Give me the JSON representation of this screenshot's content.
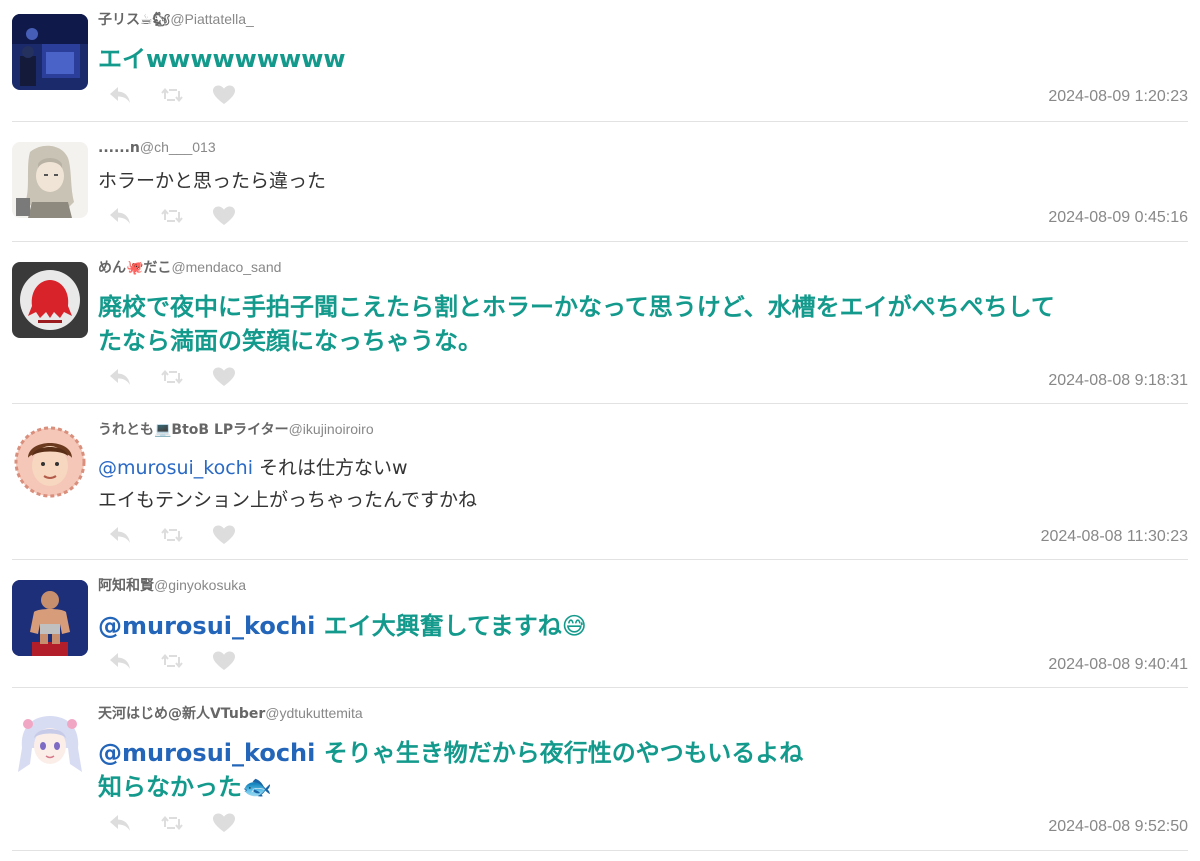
{
  "colors": {
    "accent_text": "#149a8c",
    "mention": "#2365b8",
    "meta": "#888888",
    "icon": "#dddddd",
    "divider": "#e2e2e2"
  },
  "tweets": [
    {
      "username": "子リス☕🐿",
      "handle": "@Piattatella_",
      "text_lines": [
        "エイwwwwwwwww"
      ],
      "mention": "",
      "timestamp": "2024-08-09 1:20:23",
      "style": "large",
      "avatar_icon": "aquarium-photo"
    },
    {
      "username": "......n",
      "handle": "@ch___013",
      "text_lines": [
        "ホラーかと思ったら違った"
      ],
      "mention": "",
      "timestamp": "2024-08-09 0:45:16",
      "style": "small",
      "avatar_icon": "anime-character"
    },
    {
      "username": "めん🐙だこ",
      "handle": "@mendaco_sand",
      "text_lines": [
        "廃校で夜中に手拍子聞こえたら割とホラーかなって思うけど、水槽をエイがぺちぺちして",
        "たなら満面の笑顔になっちゃうな。"
      ],
      "mention": "",
      "timestamp": "2024-08-08 9:18:31",
      "style": "large",
      "avatar_icon": "red-octopus-logo"
    },
    {
      "username": "うれとも💻BtoB LPライター",
      "handle": "@ikujinoiroiro",
      "text_lines": [
        " それは仕方ないw",
        "エイもテンション上がっちゃったんですかね"
      ],
      "mention": "@murosui_kochi",
      "timestamp": "2024-08-08 11:30:23",
      "style": "small",
      "avatar_icon": "face-illustration"
    },
    {
      "username": "阿知和賢",
      "handle": "@ginyokosuka",
      "text_lines": [
        " エイ大興奮してますね😅"
      ],
      "mention": "@murosui_kochi",
      "timestamp": "2024-08-08 9:40:41",
      "style": "large",
      "avatar_icon": "wrestler-photo"
    },
    {
      "username": "天河はじめ@新人VTuber",
      "handle": "@ydtukuttemita",
      "text_lines": [
        " そりゃ生き物だから夜行性のやつもいるよね",
        "知らなかった🐟"
      ],
      "mention": "@murosui_kochi",
      "timestamp": "2024-08-08 9:52:50",
      "style": "large",
      "avatar_icon": "vtuber-girl"
    }
  ]
}
